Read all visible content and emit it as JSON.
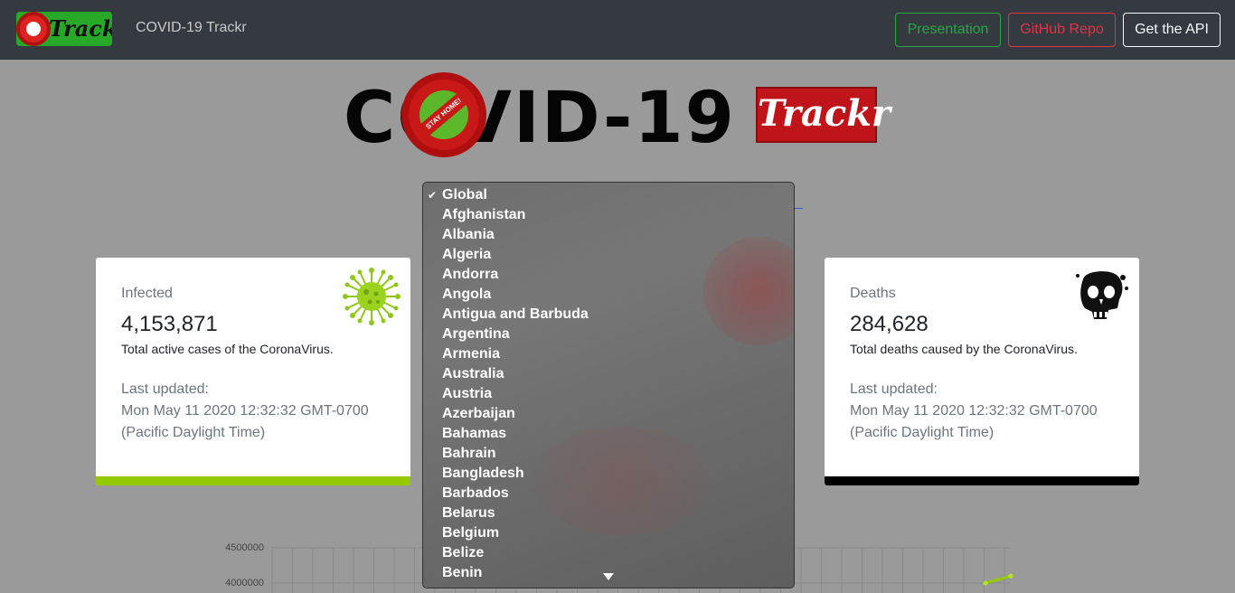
{
  "navbar": {
    "logo_text": "Trackr",
    "brand": "COVID-19 Trackr",
    "buttons": {
      "presentation": "Presentation",
      "github": "GitHub Repo",
      "api": "Get the API"
    }
  },
  "hero": {
    "title": "COVID-19",
    "seal_text": "STAY HOME!",
    "badge": "Trackr"
  },
  "dropdown": {
    "selected": "Global",
    "options": [
      "Global",
      "Afghanistan",
      "Albania",
      "Algeria",
      "Andorra",
      "Angola",
      "Antigua and Barbuda",
      "Argentina",
      "Armenia",
      "Australia",
      "Austria",
      "Azerbaijan",
      "Bahamas",
      "Bahrain",
      "Bangladesh",
      "Barbados",
      "Belarus",
      "Belgium",
      "Belize",
      "Benin"
    ]
  },
  "cards": {
    "infected": {
      "title": "Infected",
      "number": "4,153,871",
      "description": "Total active cases of the CoronaVirus.",
      "updated_label": "Last updated:",
      "updated_date": "Mon May 11 2020 12:32:32 GMT-0700",
      "updated_tz": "(Pacific Daylight Time)",
      "icon": "virus-icon",
      "accent": "#94c800"
    },
    "deaths": {
      "title": "Deaths",
      "number": "284,628",
      "description": "Total deaths caused by the CoronaVirus.",
      "updated_label": "Last updated:",
      "updated_date": "Mon May 11 2020 12:32:32 GMT-0700",
      "updated_tz": "(Pacific Daylight Time)",
      "icon": "skull-icon",
      "accent": "#000000"
    }
  },
  "chart_data": {
    "type": "line",
    "tick_labels": [
      "4500000",
      "4000000"
    ],
    "ylim": [
      4000000,
      4500000
    ],
    "grid": true,
    "series": [
      {
        "values": [
          4000000,
          4100000
        ]
      }
    ]
  }
}
